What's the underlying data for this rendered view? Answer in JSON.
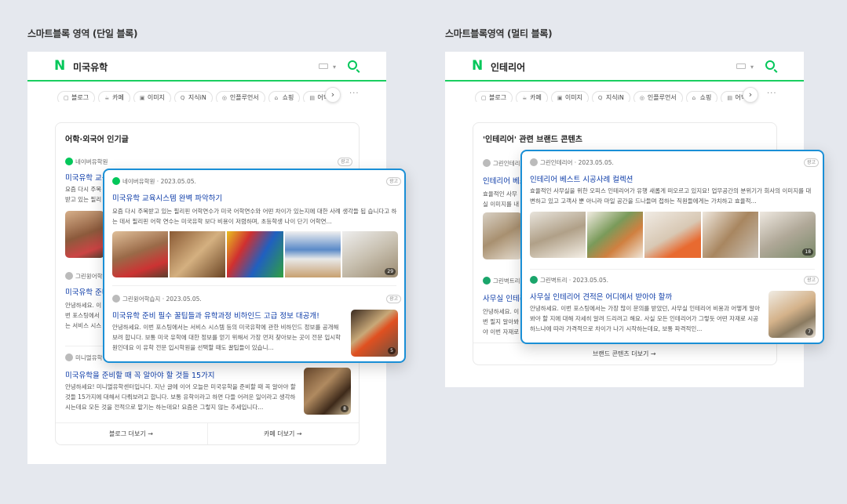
{
  "sections": {
    "single_title": "스마트블록 영역 (단일 블록)",
    "multi_title": "스마트블록영역 (멀티 블록)"
  },
  "colors": {
    "naver_green": "#03c75a",
    "link_blue": "#0d3ca8",
    "highlight_border": "#1a8fd6"
  },
  "icons": {
    "naver_logo": "N",
    "caret": "▾",
    "chevron_right": "›",
    "more": "···",
    "arrow_right": "→"
  },
  "tab_icons": [
    "▢",
    "☕",
    "▣",
    "Q",
    "◎",
    "⌂",
    "▤"
  ],
  "phone1": {
    "query": "미국유학",
    "tabs": [
      "블로그",
      "카페",
      "이미지",
      "지식iN",
      "인플루언서",
      "쇼핑",
      "어학"
    ],
    "card_title": "어학·외국어 인기글",
    "items": [
      {
        "source": "네이버유학원",
        "date": "· 2023.05.05.",
        "title": "미국유학 교육시스템 완벽 파악하기",
        "desc": "요즘 다시 주목받고 있는 필리핀 어학연수가 미국 어학연수와 어떤 차이가 있는지에 대한 사례 생각들 됩 습니다",
        "ad": "광고"
      },
      {
        "source": "그린윙어학습지",
        "date": "· 2023.05.05.",
        "title": "미국유학 준비 필수 꿀팁들과 유학과정 비하인드 고급 정보 대공개!",
        "desc": "안녕하세요. 이번 포스팅에서는 서비스 시스템 등의 미국유학에 관한 비하인드 정보를 공개해보려 합니다.",
        "ad": "광고"
      },
      {
        "source": "미니멀유학센터",
        "date": "",
        "title": "미국유학을 준비할 때 꼭 알아야 할 것들 15가지",
        "desc": "안녕하세요! 미니멀유학센터입니다. 지난 글에 이어 오늘은 미국유학을 준비할 때 꼭 알아야 할 것들 15가지에 대해서 다뤄보려고 합니다. 보통 유학이라고 하면 다들 어려운 일이라고 생각하시는데요 모든 것을 전적으로 맡기는 하는데요! 요즘은 그렇지 않는 추세입니다...",
        "badge": "8"
      }
    ],
    "footer": {
      "left": "블로그 더보기",
      "right": "카페 더보기"
    },
    "popup": [
      {
        "source": "네이버유학원",
        "date": "· 2023.05.05.",
        "title": "미국유학 교육시스템 완벽 파악하기",
        "desc": "요즘 다시 주목받고 있는 필리핀 어학연수가 미국 어학연수와 어떤 차이가 있는지에 대한 사례 생각들 됩 습니다고 하는 데서 필리핀 어학 연수는 미국유학 보다 비용이 저렴하며, 초등학생 나이 단기 어학연...",
        "ad": "광고",
        "badge": "29"
      },
      {
        "source": "그린윙어학습지",
        "date": "· 2023.05.05.",
        "title": "미국유학 준비 필수 꿀팁들과 유학과정 비하인드 고급 정보 대공개!",
        "desc": "안녕하세요. 이번 포스팅에서는 서비스 시스템 등의 미국유학에 관한 비하인드 정보를 공개해보려 합니다. 보통 미국 유학에 대한 정보를 얻기 위해서 가장 먼저 찾아보는 곳이 전문 입시학원인데요 이 유학 전문 입시학원을 선택할 때도 꿀팁들이 있습니...",
        "ad": "광고",
        "badge": "5"
      }
    ]
  },
  "phone2": {
    "query": "인테리어",
    "tabs": [
      "블로그",
      "카페",
      "이미지",
      "지식iN",
      "인플루언서",
      "쇼핑",
      "어학"
    ],
    "card_title": "'인테리어' 관련 브랜드 콘텐츠",
    "items": [
      {
        "source": "그린인테리어",
        "title": "인테리어 베스",
        "desc": "효율적인 사무실 이미지를 내밀"
      },
      {
        "source": "그린벽트리",
        "title": "사무실 인테리",
        "desc": "안녕하세요. 이번 필지 알아봐야 이번 자재로 시"
      }
    ],
    "footer": "브랜드 콘텐츠 더보기",
    "popup": [
      {
        "source": "그린인테리어",
        "date": "· 2023.05.05.",
        "title": "인테리어 베스트 시공사례 컬렉션",
        "desc": "효율적인 사무실을 위한 오피스 인테리어가 유행 새롭게 떠오르고 있지요! 업무공간의 분위기가 회사의 이미지를 대변하고 있고 고객사 뿐 아니라 마일 공간을 드나들며 접하는 직원들에게는 가치하고 효율적...",
        "ad": "광고",
        "badge": "18"
      },
      {
        "source": "그린벽트리",
        "date": "· 2023.05.05.",
        "title": "사무실 인테리어 견적은 어디에서 받아야 할까",
        "desc": "안녕하세요. 이번 포스팅에서는 가장 많이 문의를 받았던, 사무실 인테리어 비용과 어떻게 알아봐야 할 지에 대해 자세히 알려 드리려고 해요. 사실 모든 인테리어가 그렇듯 어떤 자재로 시공하느냐에 따라 가격적으로 차이가 나기 시작하는데요, 보통 파격적인...",
        "ad": "광고",
        "badge": "7"
      }
    ]
  }
}
